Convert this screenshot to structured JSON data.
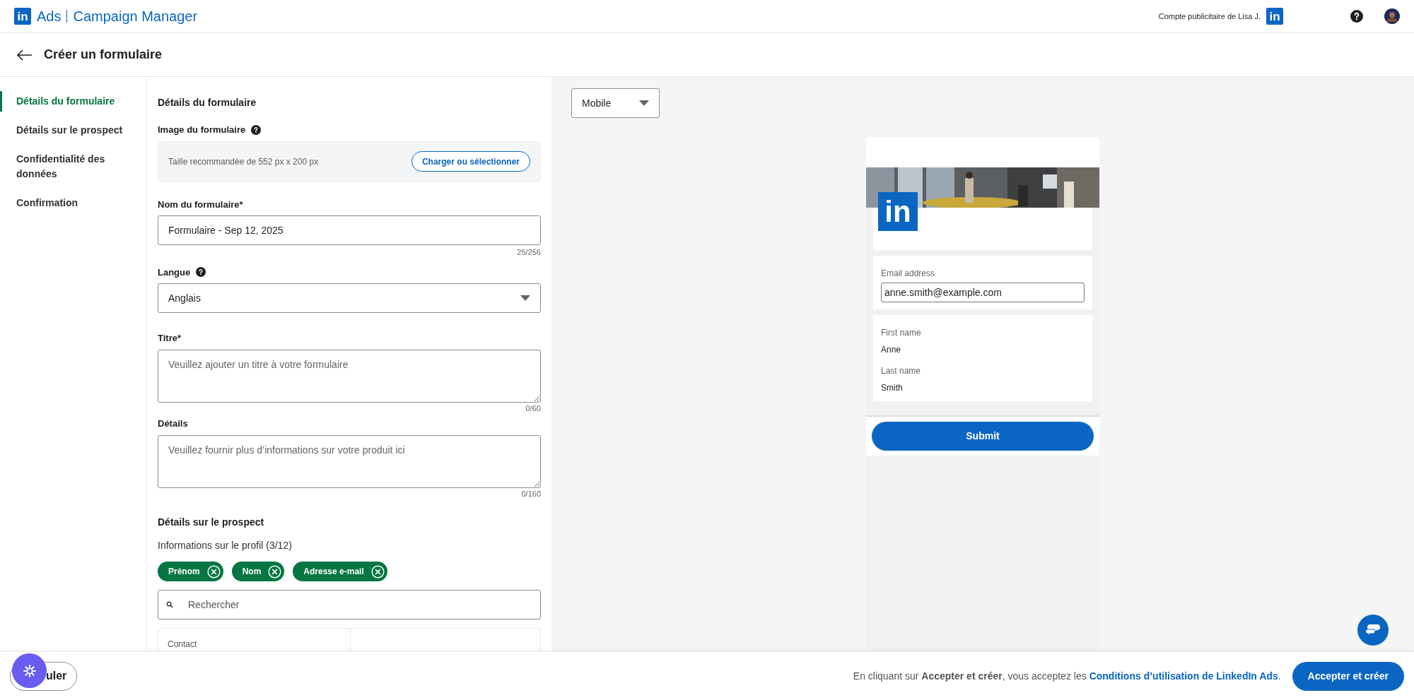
{
  "app": {
    "logo": "in",
    "product": "Ads",
    "name": "Campaign Manager"
  },
  "account": {
    "label": "Compte publicitaire de Lisa J.",
    "logo": "in"
  },
  "page": {
    "title": "Créer un formulaire"
  },
  "steps": [
    {
      "label": "Détails du formulaire",
      "selected": true
    },
    {
      "label": "Détails sur le prospect",
      "selected": false
    },
    {
      "label": "Confidentialité des données",
      "selected": false
    },
    {
      "label": "Confirmation",
      "selected": false
    }
  ],
  "form": {
    "heading": "Détails du formulaire",
    "image": {
      "label": "Image du formulaire",
      "hint": "Taille recommandée de 552 px x 200 px",
      "button": "Charger ou sélectionner"
    },
    "name": {
      "label": "Nom du formulaire*",
      "value": "Formulaire - Sep 12, 2025",
      "counter": "25/256"
    },
    "language": {
      "label": "Langue",
      "value": "Anglais"
    },
    "title": {
      "label": "Titre*",
      "placeholder": "Veuillez ajouter un titre à votre formulaire",
      "counter": "0/60"
    },
    "details": {
      "label": "Détails",
      "placeholder": "Veuillez fournir plus d’informations sur votre produit ici",
      "counter": "0/160"
    }
  },
  "prospect": {
    "heading": "Détails sur le prospect",
    "subheading": "Informations sur le profil (3/12)",
    "chips": [
      {
        "label": "Prénom"
      },
      {
        "label": "Nom"
      },
      {
        "label": "Adresse e-mail"
      }
    ],
    "search": {
      "placeholder": "Rechercher"
    },
    "table": {
      "rows": [
        {
          "column_1": "Contact"
        }
      ]
    }
  },
  "preview": {
    "device": "Mobile",
    "logo": "in",
    "cards": [
      {
        "fields": [
          {
            "kind": "input",
            "label": "Email address",
            "value": "anne.smith@example.com"
          }
        ]
      },
      {
        "fields": [
          {
            "kind": "text",
            "label": "First name",
            "value": "Anne"
          },
          {
            "kind": "text",
            "label": "Last name",
            "value": "Smith"
          }
        ]
      }
    ],
    "submit": "Submit"
  },
  "footer": {
    "cancel": "uler",
    "notice": "En cliquant sur **Accepter et créer**, vous acceptez les ",
    "link": "Conditions d’utilisation de LinkedIn Ads",
    "after": ".",
    "accept": "Accepter et créer"
  }
}
